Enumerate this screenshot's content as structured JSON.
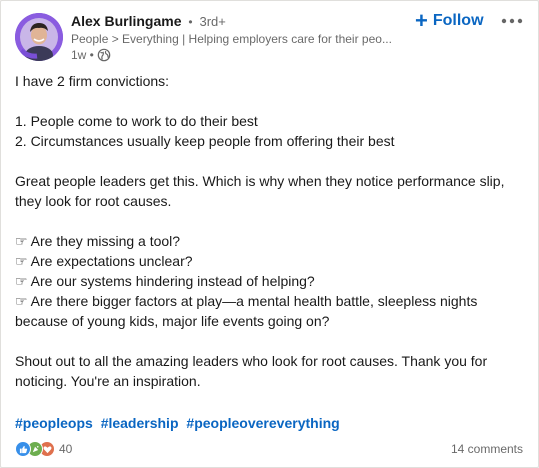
{
  "author": {
    "name": "Alex Burlingame",
    "degree": "3rd+",
    "separator": "•",
    "headline": "People > Everything | Helping employers care for their peo...",
    "time": "1w •"
  },
  "actions": {
    "follow_plus": "+",
    "follow_label": "Follow",
    "more_label": "•••"
  },
  "body": {
    "intro": "I have 2 firm convictions:",
    "convictions": [
      "1. People come to work to do their best",
      "2. Circumstances usually keep people from offering their best"
    ],
    "paragraph2_line1": "Great people leaders get this. Which is why when they notice performance slip,",
    "paragraph2_line2": "they look for root causes.",
    "questions": [
      "☞ Are they missing a tool?",
      "☞ Are expectations unclear?",
      "☞ Are our systems hindering instead of helping?",
      "☞ Are there bigger factors at play—a mental health battle, sleepless nights",
      "because of young kids, major life events going on?"
    ],
    "closing_line1": "Shout out to all the amazing leaders who look for root causes. Thank you for",
    "closing_line2": "noticing. You're an inspiration."
  },
  "hashtags": [
    "#peopleops",
    "#leadership",
    "#peopleovereverything"
  ],
  "social": {
    "reaction_count": "40",
    "reaction_icons": [
      "like-icon",
      "celebrate-icon",
      "love-icon"
    ],
    "comments": "14 comments"
  },
  "colors": {
    "link_blue": "#0a66c2",
    "avatar_purple": "#7a4fd6",
    "like_blue": "#378fe9",
    "celebrate_green": "#6dae4f",
    "love_red": "#df704d"
  }
}
